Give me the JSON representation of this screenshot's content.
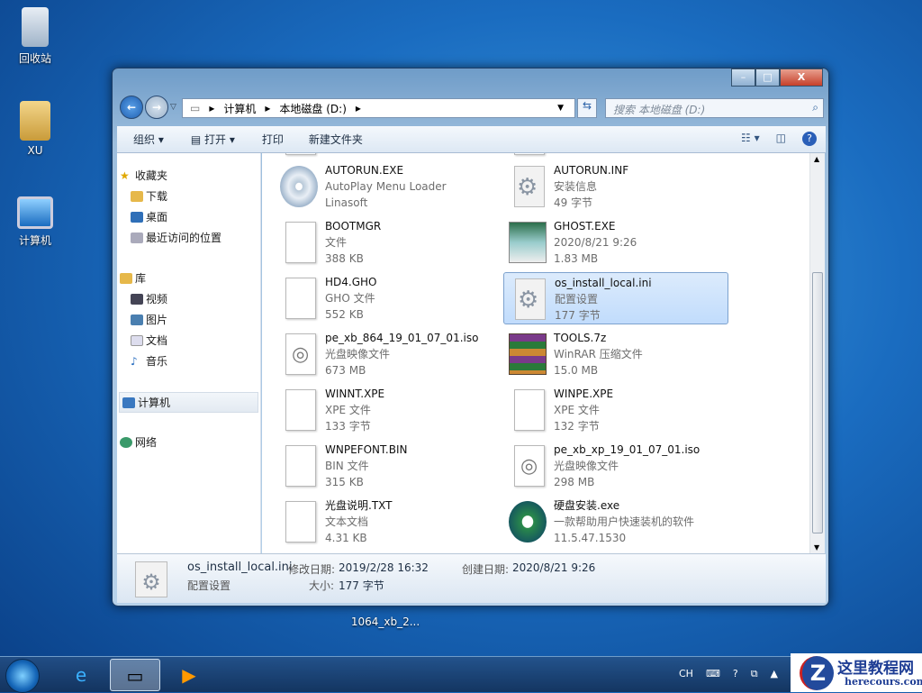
{
  "desktop": {
    "icons": [
      {
        "label": "回收站"
      },
      {
        "label": "XU"
      },
      {
        "label": "计算机"
      }
    ],
    "dragged_label": "1064_xb_2..."
  },
  "window": {
    "caption": {
      "minimize": "–",
      "maximize": "□",
      "close": "X"
    },
    "address": {
      "crumbs": [
        "计算机",
        "本地磁盘 (D:)"
      ]
    },
    "search_placeholder": "搜索 本地磁盘 (D:)",
    "toolbar": {
      "organize": "组织 ▾",
      "open": "打开 ▾",
      "print": "打印",
      "new_folder": "新建文件夹"
    },
    "nav": {
      "favorites": "收藏夹",
      "downloads": "下载",
      "desktop": "桌面",
      "recent": "最近访问的位置",
      "libraries": "库",
      "videos": "视频",
      "pictures": "图片",
      "documents": "文档",
      "music": "音乐",
      "computer": "计算机",
      "network": "网络"
    },
    "files": [
      {
        "name": "AUTORUN.EXE",
        "line2": "AutoPlay Menu Loader",
        "line3": "Linasoft",
        "icon": "cd"
      },
      {
        "name": "AUTORUN.INF",
        "line2": "安装信息",
        "line3": "49 字节",
        "icon": "gear"
      },
      {
        "name": "BOOTMGR",
        "line2": "文件",
        "line3": "388 KB",
        "icon": "doc"
      },
      {
        "name": "GHOST.EXE",
        "line2": "2020/8/21 9:26",
        "line3": "1.83 MB",
        "icon": "app"
      },
      {
        "name": "HD4.GHO",
        "line2": "GHO 文件",
        "line3": "552 KB",
        "icon": "doc"
      },
      {
        "name": "os_install_local.ini",
        "line2": "配置设置",
        "line3": "177 字节",
        "icon": "gear",
        "selected": true
      },
      {
        "name": "pe_xb_864_19_01_07_01.iso",
        "line2": "光盘映像文件",
        "line3": "673 MB",
        "icon": "disc"
      },
      {
        "name": "TOOLS.7z",
        "line2": "WinRAR 压缩文件",
        "line3": "15.0 MB",
        "icon": "rar"
      },
      {
        "name": "WINNT.XPE",
        "line2": "XPE 文件",
        "line3": "133 字节",
        "icon": "doc"
      },
      {
        "name": "WINPE.XPE",
        "line2": "XPE 文件",
        "line3": "132 字节",
        "icon": "doc"
      },
      {
        "name": "WNPEFONT.BIN",
        "line2": "BIN 文件",
        "line3": "315 KB",
        "icon": "doc"
      },
      {
        "name": "pe_xb_xp_19_01_07_01.iso",
        "line2": "光盘映像文件",
        "line3": "298 MB",
        "icon": "disc"
      },
      {
        "name": "光盘说明.TXT",
        "line2": "文本文档",
        "line3": "4.31 KB",
        "icon": "doc"
      },
      {
        "name": "硬盘安装.exe",
        "line2": "一款帮助用户快速装机的软件",
        "line3": "11.5.47.1530",
        "icon": "setup"
      }
    ],
    "status": {
      "name": "os_install_local.ini",
      "type": "配置设置",
      "modified_label": "修改日期:",
      "modified": "2019/2/28 16:32",
      "created_label": "创建日期:",
      "created": "2020/8/21 9:26",
      "size_label": "大小:",
      "size": "177 字节"
    }
  },
  "taskbar": {
    "lang": "CH"
  },
  "watermark": {
    "title": "这里教程网",
    "url": "herecours.com"
  }
}
